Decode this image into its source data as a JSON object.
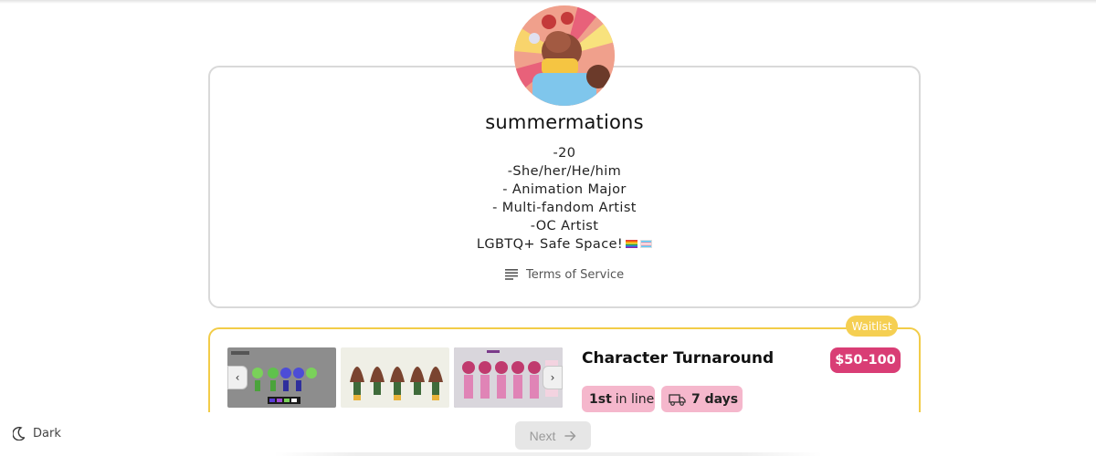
{
  "profile": {
    "username": "summermations",
    "bio_lines": [
      "-20",
      "-She/her/He/him",
      "- Animation Major",
      "- Multi-fandom Artist",
      "-OC Artist",
      "LGBTQ+ Safe Space!"
    ],
    "tos_label": "Terms of Service",
    "avatar_icon": "avatar-illustration"
  },
  "commission": {
    "status_badge": "Waitlist",
    "title": "Character Turnaround",
    "price": "$50-100",
    "queue_position": "1st",
    "queue_suffix": "in line",
    "turnaround_value": "7 days",
    "thumb_count": 3
  },
  "footer": {
    "theme_toggle_label": "Dark",
    "next_label": "Next",
    "next_disabled": true
  },
  "icons": {
    "tos": "document-lines-icon",
    "truck": "truck-icon",
    "moon": "moon-icon",
    "arrow": "arrow-right-icon",
    "prev": "chevron-left-icon",
    "next": "chevron-right-icon"
  },
  "colors": {
    "waitlist_accent": "#f2cc48",
    "price_badge": "#d93d75",
    "chip_bg": "#f5b7cc",
    "card_border": "#d9d9d9"
  }
}
